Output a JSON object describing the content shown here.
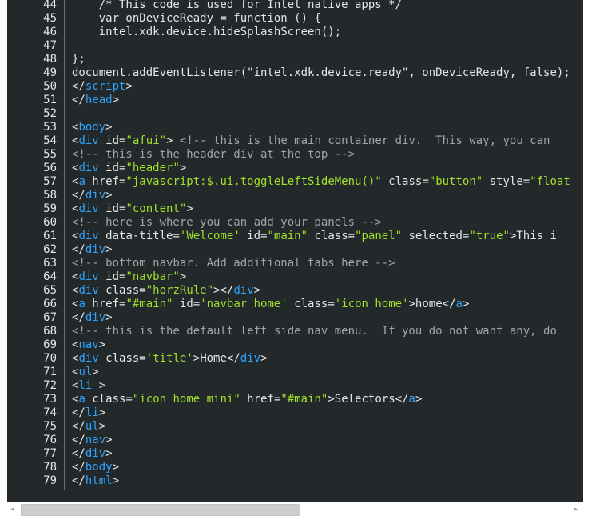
{
  "editor": {
    "lines": [
      {
        "n": "44",
        "tokens": [
          {
            "t": "    /* This code is used for Intel native apps */",
            "c": "plain"
          }
        ]
      },
      {
        "n": "45",
        "tokens": [
          {
            "t": "    var onDeviceReady = function () {",
            "c": "plain"
          }
        ]
      },
      {
        "n": "46",
        "tokens": [
          {
            "t": "    intel.xdk.device.hideSplashScreen();",
            "c": "plain"
          }
        ]
      },
      {
        "n": "47",
        "tokens": []
      },
      {
        "n": "48",
        "tokens": [
          {
            "t": "};",
            "c": "plain"
          }
        ]
      },
      {
        "n": "49",
        "tokens": [
          {
            "t": "document.addEventListener(\"intel.xdk.device.ready\", onDeviceReady, false);",
            "c": "plain"
          }
        ]
      },
      {
        "n": "50",
        "tokens": [
          {
            "t": "</",
            "c": "punct"
          },
          {
            "t": "script",
            "c": "tag"
          },
          {
            "t": ">",
            "c": "punct"
          }
        ]
      },
      {
        "n": "51",
        "tokens": [
          {
            "t": "</",
            "c": "punct"
          },
          {
            "t": "head",
            "c": "tag"
          },
          {
            "t": ">",
            "c": "punct"
          }
        ]
      },
      {
        "n": "52",
        "tokens": []
      },
      {
        "n": "53",
        "tokens": [
          {
            "t": "<",
            "c": "punct"
          },
          {
            "t": "body",
            "c": "tag"
          },
          {
            "t": ">",
            "c": "punct"
          }
        ]
      },
      {
        "n": "54",
        "tokens": [
          {
            "t": "<",
            "c": "punct"
          },
          {
            "t": "div",
            "c": "tag"
          },
          {
            "t": " id=",
            "c": "attr"
          },
          {
            "t": "\"afui\"",
            "c": "str"
          },
          {
            "t": "> ",
            "c": "punct"
          },
          {
            "t": "<!-- this is the main container div.  This way, you can",
            "c": "comment"
          }
        ]
      },
      {
        "n": "55",
        "tokens": [
          {
            "t": "<!-- this is the header div at the top -->",
            "c": "comment"
          }
        ]
      },
      {
        "n": "56",
        "tokens": [
          {
            "t": "<",
            "c": "punct"
          },
          {
            "t": "div",
            "c": "tag"
          },
          {
            "t": " id=",
            "c": "attr"
          },
          {
            "t": "\"header\"",
            "c": "str"
          },
          {
            "t": ">",
            "c": "punct"
          }
        ]
      },
      {
        "n": "57",
        "tokens": [
          {
            "t": "<",
            "c": "punct"
          },
          {
            "t": "a",
            "c": "tag"
          },
          {
            "t": " href=",
            "c": "attr"
          },
          {
            "t": "\"javascript:$.ui.toggleLeftSideMenu()\"",
            "c": "str"
          },
          {
            "t": " class=",
            "c": "attr"
          },
          {
            "t": "\"button\"",
            "c": "str"
          },
          {
            "t": " style=",
            "c": "attr"
          },
          {
            "t": "\"float",
            "c": "str"
          }
        ]
      },
      {
        "n": "58",
        "tokens": [
          {
            "t": "</",
            "c": "punct"
          },
          {
            "t": "div",
            "c": "tag"
          },
          {
            "t": ">",
            "c": "punct"
          }
        ]
      },
      {
        "n": "59",
        "tokens": [
          {
            "t": "<",
            "c": "punct"
          },
          {
            "t": "div",
            "c": "tag"
          },
          {
            "t": " id=",
            "c": "attr"
          },
          {
            "t": "\"content\"",
            "c": "str"
          },
          {
            "t": ">",
            "c": "punct"
          }
        ]
      },
      {
        "n": "60",
        "tokens": [
          {
            "t": "<!-- here is where you can add your panels -->",
            "c": "comment"
          }
        ]
      },
      {
        "n": "61",
        "tokens": [
          {
            "t": "<",
            "c": "punct"
          },
          {
            "t": "div",
            "c": "tag"
          },
          {
            "t": " data-title=",
            "c": "attr"
          },
          {
            "t": "'Welcome'",
            "c": "str"
          },
          {
            "t": " id=",
            "c": "attr"
          },
          {
            "t": "\"main\"",
            "c": "str"
          },
          {
            "t": " class=",
            "c": "attr"
          },
          {
            "t": "\"panel\"",
            "c": "str"
          },
          {
            "t": " selected=",
            "c": "attr"
          },
          {
            "t": "\"true\"",
            "c": "str"
          },
          {
            "t": ">This i",
            "c": "plain"
          }
        ]
      },
      {
        "n": "62",
        "tokens": [
          {
            "t": "</",
            "c": "punct"
          },
          {
            "t": "div",
            "c": "tag"
          },
          {
            "t": ">",
            "c": "punct"
          }
        ]
      },
      {
        "n": "63",
        "tokens": [
          {
            "t": "<!-- bottom navbar. Add additional tabs here -->",
            "c": "comment"
          }
        ]
      },
      {
        "n": "64",
        "tokens": [
          {
            "t": "<",
            "c": "punct"
          },
          {
            "t": "div",
            "c": "tag"
          },
          {
            "t": " id=",
            "c": "attr"
          },
          {
            "t": "\"navbar\"",
            "c": "str"
          },
          {
            "t": ">",
            "c": "punct"
          }
        ]
      },
      {
        "n": "65",
        "tokens": [
          {
            "t": "<",
            "c": "punct"
          },
          {
            "t": "div",
            "c": "tag"
          },
          {
            "t": " class=",
            "c": "attr"
          },
          {
            "t": "\"horzRule\"",
            "c": "str"
          },
          {
            "t": "></",
            "c": "punct"
          },
          {
            "t": "div",
            "c": "tag"
          },
          {
            "t": ">",
            "c": "punct"
          }
        ]
      },
      {
        "n": "66",
        "tokens": [
          {
            "t": "<",
            "c": "punct"
          },
          {
            "t": "a",
            "c": "tag"
          },
          {
            "t": " href=",
            "c": "attr"
          },
          {
            "t": "\"#main\"",
            "c": "str"
          },
          {
            "t": " id=",
            "c": "attr"
          },
          {
            "t": "'navbar_home'",
            "c": "str"
          },
          {
            "t": " class=",
            "c": "attr"
          },
          {
            "t": "'icon home'",
            "c": "str"
          },
          {
            "t": ">home</",
            "c": "punct"
          },
          {
            "t": "a",
            "c": "tag"
          },
          {
            "t": ">",
            "c": "punct"
          }
        ]
      },
      {
        "n": "67",
        "tokens": [
          {
            "t": "</",
            "c": "punct"
          },
          {
            "t": "div",
            "c": "tag"
          },
          {
            "t": ">",
            "c": "punct"
          }
        ]
      },
      {
        "n": "68",
        "tokens": [
          {
            "t": "<!-- this is the default left side nav menu.  If you do not want any, do",
            "c": "comment"
          }
        ]
      },
      {
        "n": "69",
        "tokens": [
          {
            "t": "<",
            "c": "punct"
          },
          {
            "t": "nav",
            "c": "tag"
          },
          {
            "t": ">",
            "c": "punct"
          }
        ]
      },
      {
        "n": "70",
        "tokens": [
          {
            "t": "<",
            "c": "punct"
          },
          {
            "t": "div",
            "c": "tag"
          },
          {
            "t": " class=",
            "c": "attr"
          },
          {
            "t": "'title'",
            "c": "str"
          },
          {
            "t": ">Home</",
            "c": "punct"
          },
          {
            "t": "div",
            "c": "tag"
          },
          {
            "t": ">",
            "c": "punct"
          }
        ]
      },
      {
        "n": "71",
        "tokens": [
          {
            "t": "<",
            "c": "punct"
          },
          {
            "t": "ul",
            "c": "tag"
          },
          {
            "t": ">",
            "c": "punct"
          }
        ]
      },
      {
        "n": "72",
        "tokens": [
          {
            "t": "<",
            "c": "punct"
          },
          {
            "t": "li",
            "c": "tag"
          },
          {
            "t": " >",
            "c": "punct"
          }
        ]
      },
      {
        "n": "73",
        "tokens": [
          {
            "t": "<",
            "c": "punct"
          },
          {
            "t": "a",
            "c": "tag"
          },
          {
            "t": " class=",
            "c": "attr"
          },
          {
            "t": "\"icon home mini\"",
            "c": "str"
          },
          {
            "t": " href=",
            "c": "attr"
          },
          {
            "t": "\"#main\"",
            "c": "str"
          },
          {
            "t": ">Selectors</",
            "c": "punct"
          },
          {
            "t": "a",
            "c": "tag"
          },
          {
            "t": ">",
            "c": "punct"
          }
        ]
      },
      {
        "n": "74",
        "tokens": [
          {
            "t": "</",
            "c": "punct"
          },
          {
            "t": "li",
            "c": "tag"
          },
          {
            "t": ">",
            "c": "punct"
          }
        ]
      },
      {
        "n": "75",
        "tokens": [
          {
            "t": "</",
            "c": "punct"
          },
          {
            "t": "ul",
            "c": "tag"
          },
          {
            "t": ">",
            "c": "punct"
          }
        ]
      },
      {
        "n": "76",
        "tokens": [
          {
            "t": "</",
            "c": "punct"
          },
          {
            "t": "nav",
            "c": "tag"
          },
          {
            "t": ">",
            "c": "punct"
          }
        ]
      },
      {
        "n": "77",
        "tokens": [
          {
            "t": "</",
            "c": "punct"
          },
          {
            "t": "div",
            "c": "tag"
          },
          {
            "t": ">",
            "c": "punct"
          }
        ]
      },
      {
        "n": "78",
        "tokens": [
          {
            "t": "</",
            "c": "punct"
          },
          {
            "t": "body",
            "c": "tag"
          },
          {
            "t": ">",
            "c": "punct"
          }
        ]
      },
      {
        "n": "79",
        "tokens": [
          {
            "t": "</",
            "c": "punct"
          },
          {
            "t": "html",
            "c": "tag"
          },
          {
            "t": ">",
            "c": "punct"
          }
        ]
      }
    ]
  },
  "scrollbar": {
    "left_arrow_icon": "◂",
    "right_arrow_icon": "▸",
    "position_fraction": 0.0
  },
  "colors": {
    "background": "#23292b",
    "tag": "#2ea4ff",
    "string": "#a0e12a",
    "comment": "#a0a6a8",
    "text": "#e6e6e6"
  }
}
